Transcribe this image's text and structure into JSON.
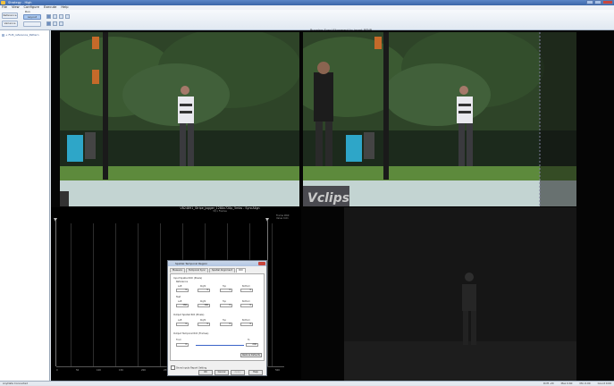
{
  "window": {
    "title": "Strategy - High"
  },
  "menu": [
    "File",
    "View",
    "Configure",
    "Execute",
    "Help"
  ],
  "ribbon": {
    "mode_label": "Run",
    "buttons": [
      "Reference",
      "Variance",
      "Layout"
    ],
    "status_message": "Running Sync/Alignment to insert PSNR..."
  },
  "sidebar": {
    "items": [
      "+ FLM_reference_Pattern"
    ]
  },
  "plot": {
    "overlay_title": "VB24891_Stripe_Jogger_1280x720p_5mbs - SyncAlign",
    "overlay_sub": "3Q x Frames",
    "info_line1": "Frame #60",
    "info_line2": "Value 0.61",
    "x_ticks": [
      "0",
      "50",
      "100",
      "150",
      "200",
      "250",
      "300",
      "350",
      "400",
      "450",
      "500"
    ]
  },
  "dialog": {
    "title": "Spatial Temporal Region",
    "tabs": [
      "Measure",
      "Temporal Sync",
      "Spatial Alignment",
      "ROI"
    ],
    "group_input": "Input Spatial ROI (Pixels)",
    "sub_reference": "Reference",
    "sub_test": "Test",
    "group_output": "Output Spatial ROI (Pixels)",
    "group_temporal": "Output Temporal ROI (Frames)",
    "col_left": "Left",
    "col_right": "Right",
    "col_top": "Top",
    "col_bottom": "Bottom",
    "ref_values": [
      "0",
      "0",
      "0",
      "0"
    ],
    "test_values": [
      "160",
      "160",
      "0",
      "0"
    ],
    "out_values": [
      "0",
      "0",
      "0",
      "0"
    ],
    "temporal_from_label": "From",
    "temporal_to_label": "To",
    "temporal_from": "0",
    "temporal_to": "240",
    "restore_button": "Restore Defaults",
    "checkbox_label": "Show Inputs Report Setting",
    "ok": "OK",
    "cancel": "Cancel",
    "apply": "Apply",
    "help": "Help"
  },
  "statusbar": {
    "left": "AnyData Connected",
    "right": [
      "Drift -20",
      "Max 0.60",
      "Min 0.00",
      "Count 0.00"
    ]
  }
}
